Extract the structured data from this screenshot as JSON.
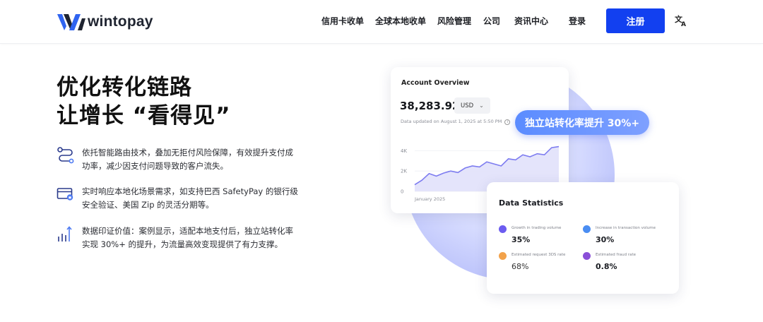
{
  "brand": {
    "name": "wintopay",
    "colors": {
      "primary": "#1240f0",
      "logo_dark": "#1f2430",
      "logo_blue": "#2f64f0"
    }
  },
  "nav": {
    "items": [
      {
        "label": "信用卡收单"
      },
      {
        "label": "全球本地收单"
      },
      {
        "label": "风险管理"
      },
      {
        "label": "公司"
      },
      {
        "label": "资讯中心"
      }
    ],
    "login": "登录",
    "signup": "注册",
    "language_icon": "translate-icon"
  },
  "hero": {
    "headline_line1": "优化转化链路",
    "headline_line2": "让增长 “看得见”",
    "features": [
      {
        "icon": "route-icon",
        "text": "依托智能路由技术，叠加无拒付风险保障，有效提升支付成功率，减少因支付问题导致的客户流失。"
      },
      {
        "icon": "card-lock-icon",
        "text": "实时响应本地化场景需求，如支持巴西 SafetyPay 的银行级安全验证、美国 Zip 的灵活分期等。"
      },
      {
        "icon": "bar-growth-icon",
        "text": "数据印证价值：案例显示，适配本地支付后，独立站转化率实现 30%+ 的提升，为流量高效变现提供了有力支撑。"
      }
    ]
  },
  "account_card": {
    "title": "Account Overview",
    "amount": "38,283.92",
    "currency": "USD",
    "updated": "Data updated on August 1, 2025 at 5:50 PM"
  },
  "badge": {
    "text": "独立站转化率提升 30%+"
  },
  "stats_card": {
    "title": "Data Statistics",
    "items": [
      {
        "label": "Growth in trading volume",
        "value": "35%",
        "color": "#6c5cf0"
      },
      {
        "label": "Increase in transaction volume",
        "value": "30%",
        "color": "#4a8df2"
      },
      {
        "label": "Estimated request 3DS rate",
        "value": "68%",
        "color": "#f2a24a"
      },
      {
        "label": "Estimated fraud rate",
        "value": "0.8%",
        "color": "#8a4fd8"
      }
    ]
  },
  "chart_data": {
    "type": "area",
    "x_tick_labels": [
      "January 2025"
    ],
    "y_tick_labels": [
      "4K",
      "2K",
      "0"
    ],
    "ylim": [
      0,
      5000
    ],
    "x": [
      0,
      1,
      2,
      3,
      4,
      5,
      6,
      7,
      8,
      9,
      10,
      11,
      12,
      13,
      14,
      15,
      16,
      17,
      18,
      19,
      20
    ],
    "values": [
      650,
      1100,
      1750,
      1500,
      1800,
      2000,
      1850,
      2300,
      2500,
      2400,
      2900,
      2700,
      2500,
      3200,
      3100,
      3600,
      3400,
      3700,
      3600,
      4300,
      4400
    ],
    "series_color": "#7d7cf0",
    "grid": true
  }
}
